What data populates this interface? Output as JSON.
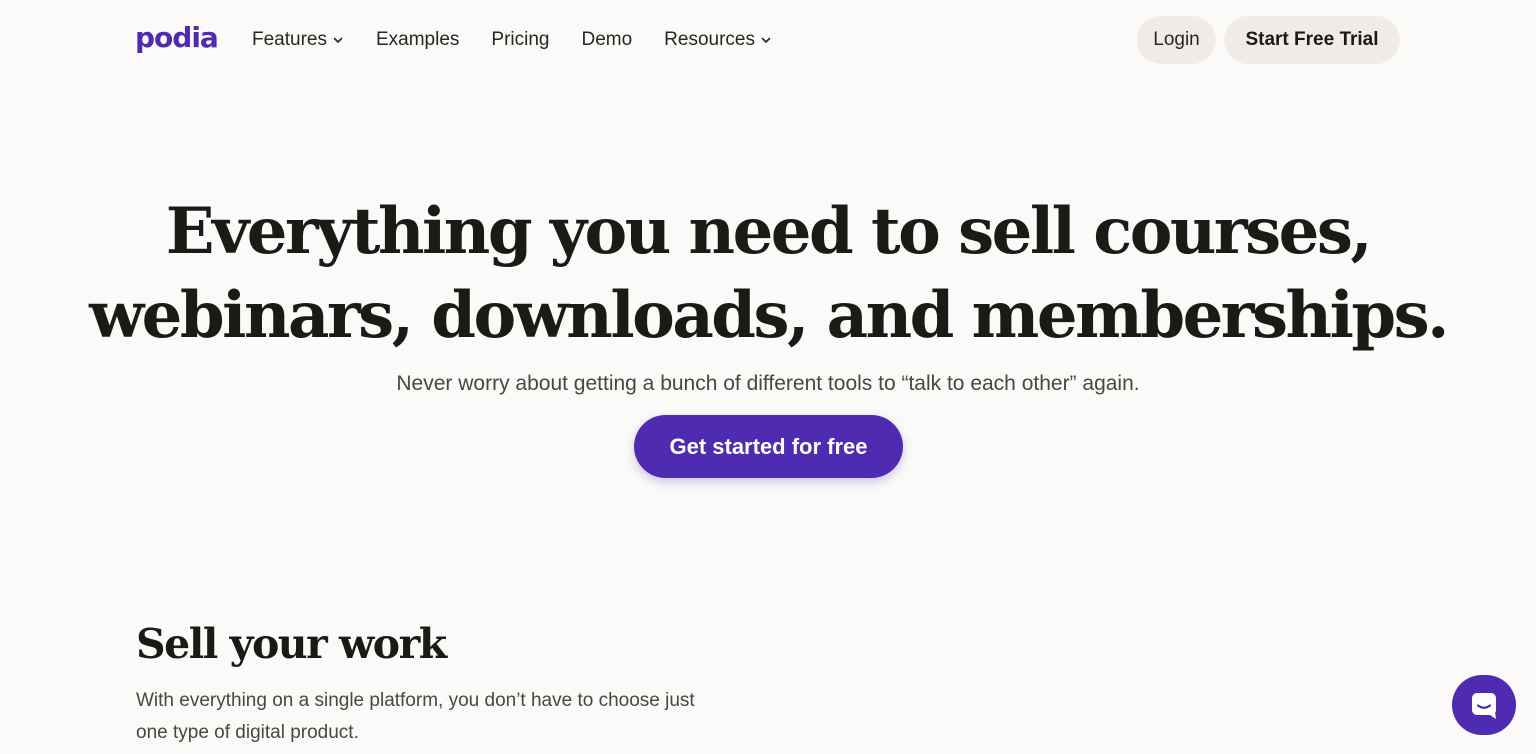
{
  "brand": {
    "logo_text": "podia",
    "accent_color": "#4e2bb0"
  },
  "nav": {
    "links": [
      {
        "label": "Features",
        "has_dropdown": true
      },
      {
        "label": "Examples",
        "has_dropdown": false
      },
      {
        "label": "Pricing",
        "has_dropdown": false
      },
      {
        "label": "Demo",
        "has_dropdown": false
      },
      {
        "label": "Resources",
        "has_dropdown": true
      }
    ],
    "login_label": "Login",
    "trial_label": "Start Free Trial"
  },
  "hero": {
    "title": "Everything you need to sell courses, webinars, downloads, and memberships.",
    "subtitle": "Never worry about getting a bunch of different tools to “talk to each other” again.",
    "cta_label": "Get started for free"
  },
  "section": {
    "title": "Sell your work",
    "text": "With everything on a single platform, you don’t have to choose just one type of digital product."
  },
  "chat": {
    "icon": "chat-icon"
  }
}
